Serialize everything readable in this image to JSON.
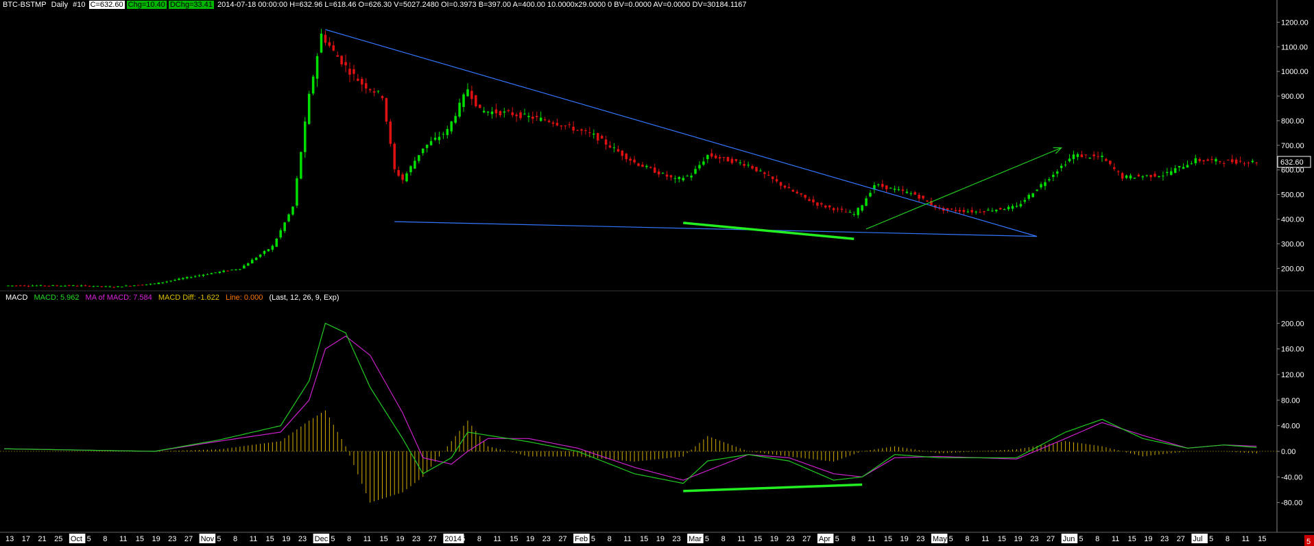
{
  "header": {
    "symbol": "BTC-BSTMP",
    "period": "Daily",
    "number": "#10",
    "close": "C=632.60",
    "chg": "Chg=10.40",
    "dchg": "DChg=33.41",
    "details": "2014-07-18 00:00:00 H=632.96 L=618.46 O=626.30 V=5027.2480 OI=0.3973 B=397.00 A=400.00 10.0000x29.0000 0 BV=0.0000 AV=0.0000 DV=30184.1167"
  },
  "macd_header": {
    "title": "MACD",
    "macd": "MACD: 5.962",
    "ma": "MA of MACD: 7.584",
    "diff": "MACD Diff: -1.622",
    "line": "Line: 0.000",
    "params": "(Last, 12, 26, 9, Exp)"
  },
  "colors": {
    "background": "#000000",
    "up": "#00dd00",
    "down": "#dd1111",
    "trendline": "#3377ff",
    "arrow": "#22cc22",
    "highlight": "#22ee22",
    "macd": "#22cc22",
    "signal": "#cc22cc",
    "histogram": "#d4b000"
  },
  "price_label": "632.60",
  "corner_badge": "5",
  "chart_data": [
    {
      "type": "candlestick",
      "title": "BTC-BSTMP Daily",
      "ylim": [
        120,
        1240
      ],
      "yticks": [
        "200.00",
        "300.00",
        "400.00",
        "500.00",
        "600.00",
        "700.00",
        "800.00",
        "900.00",
        "1000.00",
        "1100.00",
        "1200.00"
      ],
      "last_price": 632.6,
      "path_control_points": [
        [
          "2013-09-13",
          130
        ],
        [
          "2013-10-01",
          130
        ],
        [
          "2013-10-10",
          125
        ],
        [
          "2013-10-20",
          138
        ],
        [
          "2013-11-01",
          175
        ],
        [
          "2013-11-10",
          200
        ],
        [
          "2013-11-18",
          290
        ],
        [
          "2013-11-23",
          450
        ],
        [
          "2013-11-27",
          900
        ],
        [
          "2013-11-30",
          1150
        ],
        [
          "2013-12-03",
          1080
        ],
        [
          "2013-12-07",
          1000
        ],
        [
          "2013-12-10",
          950
        ],
        [
          "2013-12-15",
          900
        ],
        [
          "2013-12-18",
          600
        ],
        [
          "2013-12-20",
          560
        ],
        [
          "2013-12-25",
          690
        ],
        [
          "2013-12-31",
          760
        ],
        [
          "2014-01-05",
          930
        ],
        [
          "2014-01-08",
          840
        ],
        [
          "2014-01-15",
          830
        ],
        [
          "2014-01-25",
          800
        ],
        [
          "2014-02-05",
          740
        ],
        [
          "2014-02-15",
          630
        ],
        [
          "2014-02-25",
          560
        ],
        [
          "2014-03-01",
          580
        ],
        [
          "2014-03-05",
          660
        ],
        [
          "2014-03-15",
          620
        ],
        [
          "2014-03-25",
          520
        ],
        [
          "2014-04-01",
          460
        ],
        [
          "2014-04-10",
          420
        ],
        [
          "2014-04-12",
          460
        ],
        [
          "2014-04-15",
          540
        ],
        [
          "2014-04-25",
          500
        ],
        [
          "2014-05-01",
          440
        ],
        [
          "2014-05-10",
          430
        ],
        [
          "2014-05-20",
          450
        ],
        [
          "2014-05-30",
          600
        ],
        [
          "2014-06-03",
          660
        ],
        [
          "2014-06-10",
          650
        ],
        [
          "2014-06-15",
          570
        ],
        [
          "2014-06-25",
          580
        ],
        [
          "2014-07-03",
          640
        ],
        [
          "2014-07-10",
          635
        ],
        [
          "2014-07-18",
          632.6
        ]
      ]
    },
    {
      "type": "line",
      "title": "MACD",
      "ylim": [
        -120,
        225
      ],
      "yticks": [
        "-80.00",
        "-40.00",
        "0.00",
        "40.00",
        "80.00",
        "120.00",
        "160.00",
        "200.00"
      ],
      "series": [
        {
          "name": "MACD",
          "points": [
            [
              "2013-09-13",
              4
            ],
            [
              "2013-10-20",
              0
            ],
            [
              "2013-11-05",
              18
            ],
            [
              "2013-11-20",
              40
            ],
            [
              "2013-11-27",
              110
            ],
            [
              "2013-12-01",
              200
            ],
            [
              "2013-12-06",
              185
            ],
            [
              "2013-12-12",
              100
            ],
            [
              "2013-12-20",
              20
            ],
            [
              "2013-12-25",
              -35
            ],
            [
              "2014-01-01",
              -10
            ],
            [
              "2014-01-05",
              30
            ],
            [
              "2014-01-10",
              25
            ],
            [
              "2014-01-20",
              15
            ],
            [
              "2014-02-01",
              0
            ],
            [
              "2014-02-15",
              -35
            ],
            [
              "2014-02-27",
              -50
            ],
            [
              "2014-03-05",
              -15
            ],
            [
              "2014-03-15",
              -5
            ],
            [
              "2014-03-25",
              -15
            ],
            [
              "2014-04-05",
              -45
            ],
            [
              "2014-04-12",
              -40
            ],
            [
              "2014-04-20",
              -5
            ],
            [
              "2014-05-01",
              -10
            ],
            [
              "2014-05-20",
              -10
            ],
            [
              "2014-06-01",
              30
            ],
            [
              "2014-06-10",
              50
            ],
            [
              "2014-06-20",
              20
            ],
            [
              "2014-07-01",
              5
            ],
            [
              "2014-07-10",
              10
            ],
            [
              "2014-07-18",
              6
            ]
          ]
        },
        {
          "name": "MA of MACD",
          "points": [
            [
              "2013-09-13",
              4
            ],
            [
              "2013-10-20",
              0
            ],
            [
              "2013-11-05",
              16
            ],
            [
              "2013-11-20",
              30
            ],
            [
              "2013-11-27",
              80
            ],
            [
              "2013-12-01",
              160
            ],
            [
              "2013-12-06",
              180
            ],
            [
              "2013-12-12",
              150
            ],
            [
              "2013-12-20",
              60
            ],
            [
              "2013-12-25",
              -10
            ],
            [
              "2014-01-01",
              -20
            ],
            [
              "2014-01-05",
              0
            ],
            [
              "2014-01-10",
              20
            ],
            [
              "2014-01-20",
              20
            ],
            [
              "2014-02-01",
              5
            ],
            [
              "2014-02-15",
              -25
            ],
            [
              "2014-02-27",
              -45
            ],
            [
              "2014-03-05",
              -30
            ],
            [
              "2014-03-15",
              -5
            ],
            [
              "2014-03-25",
              -10
            ],
            [
              "2014-04-05",
              -35
            ],
            [
              "2014-04-12",
              -40
            ],
            [
              "2014-04-20",
              -10
            ],
            [
              "2014-05-01",
              -8
            ],
            [
              "2014-05-20",
              -12
            ],
            [
              "2014-06-01",
              20
            ],
            [
              "2014-06-10",
              45
            ],
            [
              "2014-06-20",
              25
            ],
            [
              "2014-07-01",
              5
            ],
            [
              "2014-07-10",
              10
            ],
            [
              "2014-07-18",
              8
            ]
          ]
        }
      ]
    }
  ],
  "x_axis": {
    "labels": [
      {
        "text": "13",
        "month": false
      },
      {
        "text": "17",
        "month": false
      },
      {
        "text": "21",
        "month": false
      },
      {
        "text": "25",
        "month": false
      },
      {
        "text": "Oct",
        "month": true
      },
      {
        "text": "5",
        "month": false
      },
      {
        "text": "8",
        "month": false
      },
      {
        "text": "11",
        "month": false
      },
      {
        "text": "15",
        "month": false
      },
      {
        "text": "19",
        "month": false
      },
      {
        "text": "23",
        "month": false
      },
      {
        "text": "27",
        "month": false
      },
      {
        "text": "Nov",
        "month": true
      },
      {
        "text": "5",
        "month": false
      },
      {
        "text": "8",
        "month": false
      },
      {
        "text": "11",
        "month": false
      },
      {
        "text": "15",
        "month": false
      },
      {
        "text": "19",
        "month": false
      },
      {
        "text": "23",
        "month": false
      },
      {
        "text": "Dec",
        "month": true
      },
      {
        "text": "5",
        "month": false
      },
      {
        "text": "8",
        "month": false
      },
      {
        "text": "11",
        "month": false
      },
      {
        "text": "15",
        "month": false
      },
      {
        "text": "19",
        "month": false
      },
      {
        "text": "23",
        "month": false
      },
      {
        "text": "27",
        "month": false
      },
      {
        "text": "2014",
        "month": true
      },
      {
        "text": "5",
        "month": false
      },
      {
        "text": "8",
        "month": false
      },
      {
        "text": "11",
        "month": false
      },
      {
        "text": "15",
        "month": false
      },
      {
        "text": "19",
        "month": false
      },
      {
        "text": "23",
        "month": false
      },
      {
        "text": "27",
        "month": false
      },
      {
        "text": "Feb",
        "month": true
      },
      {
        "text": "5",
        "month": false
      },
      {
        "text": "8",
        "month": false
      },
      {
        "text": "11",
        "month": false
      },
      {
        "text": "15",
        "month": false
      },
      {
        "text": "19",
        "month": false
      },
      {
        "text": "23",
        "month": false
      },
      {
        "text": "Mar",
        "month": true
      },
      {
        "text": "5",
        "month": false
      },
      {
        "text": "8",
        "month": false
      },
      {
        "text": "11",
        "month": false
      },
      {
        "text": "15",
        "month": false
      },
      {
        "text": "19",
        "month": false
      },
      {
        "text": "23",
        "month": false
      },
      {
        "text": "27",
        "month": false
      },
      {
        "text": "Apr",
        "month": true
      },
      {
        "text": "5",
        "month": false
      },
      {
        "text": "8",
        "month": false
      },
      {
        "text": "11",
        "month": false
      },
      {
        "text": "15",
        "month": false
      },
      {
        "text": "19",
        "month": false
      },
      {
        "text": "23",
        "month": false
      },
      {
        "text": "May",
        "month": true
      },
      {
        "text": "5",
        "month": false
      },
      {
        "text": "8",
        "month": false
      },
      {
        "text": "11",
        "month": false
      },
      {
        "text": "15",
        "month": false
      },
      {
        "text": "19",
        "month": false
      },
      {
        "text": "23",
        "month": false
      },
      {
        "text": "27",
        "month": false
      },
      {
        "text": "Jun",
        "month": true
      },
      {
        "text": "5",
        "month": false
      },
      {
        "text": "8",
        "month": false
      },
      {
        "text": "11",
        "month": false
      },
      {
        "text": "15",
        "month": false
      },
      {
        "text": "19",
        "month": false
      },
      {
        "text": "23",
        "month": false
      },
      {
        "text": "27",
        "month": false
      },
      {
        "text": "Jul",
        "month": true
      },
      {
        "text": "5",
        "month": false
      },
      {
        "text": "8",
        "month": false
      },
      {
        "text": "11",
        "month": false
      },
      {
        "text": "15",
        "month": false
      }
    ]
  },
  "drawings": [
    {
      "kind": "trendline",
      "from": [
        "2013-12-01",
        1170
      ],
      "to": [
        "2014-05-25",
        330
      ]
    },
    {
      "kind": "trendline",
      "from": [
        "2013-12-18",
        390
      ],
      "to": [
        "2014-05-25",
        330
      ]
    },
    {
      "kind": "highlight",
      "from": [
        "2014-02-27",
        385
      ],
      "to": [
        "2014-04-10",
        320
      ]
    },
    {
      "kind": "arrow",
      "from": [
        "2014-04-13",
        360
      ],
      "to": [
        "2014-05-31",
        690
      ]
    },
    {
      "kind": "highlight_macd",
      "from": [
        "2014-02-27",
        -62
      ],
      "to": [
        "2014-04-12",
        -52
      ]
    }
  ]
}
